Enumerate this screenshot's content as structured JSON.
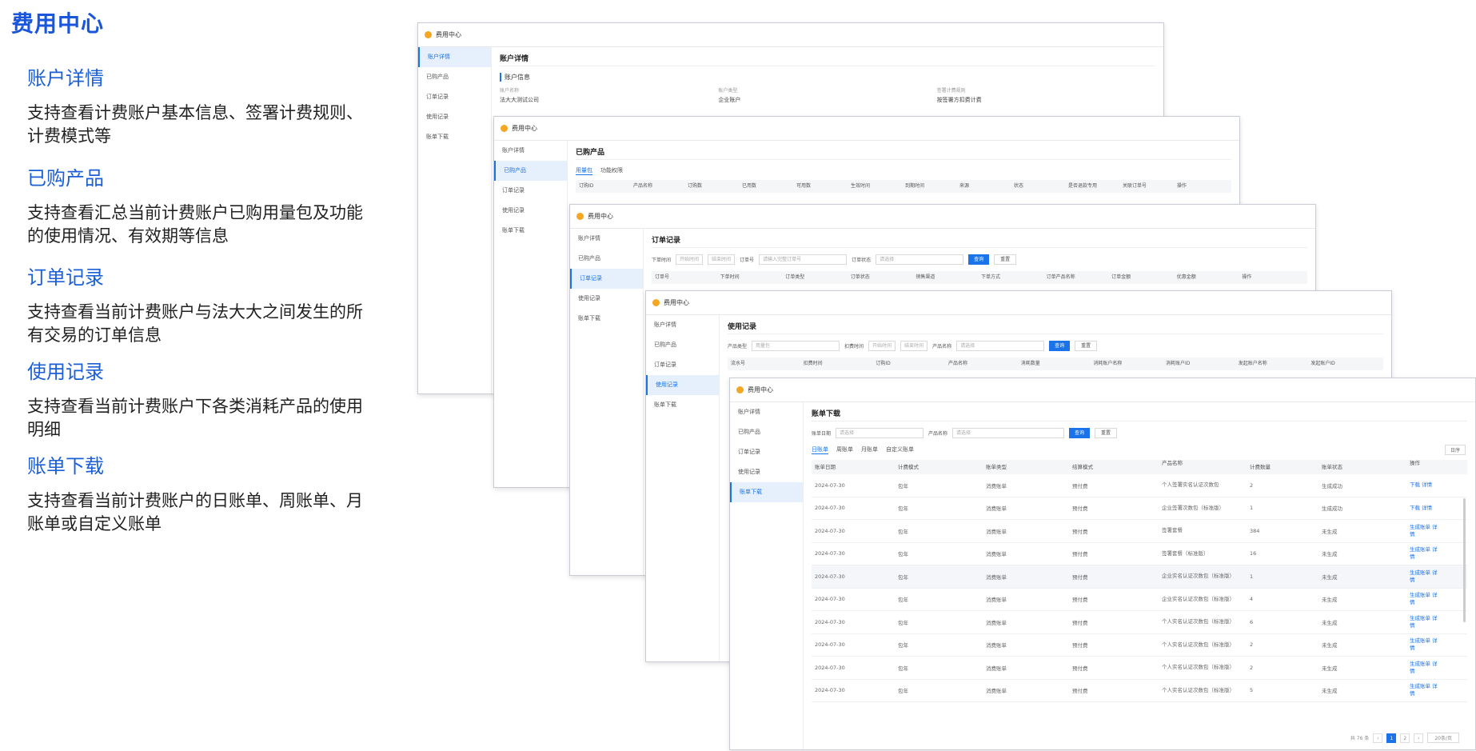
{
  "page": {
    "title": "费用中心",
    "features": [
      {
        "title": "账户详情",
        "desc": "支持查看计费账户基本信息、签署计费规则、计费模式等"
      },
      {
        "title": "已购产品",
        "desc": "支持查看汇总当前计费账户已购用量包及功能的使用情况、有效期等信息"
      },
      {
        "title": "订单记录",
        "desc": "支持查看当前计费账户与法大大之间发生的所有交易的订单信息"
      },
      {
        "title": "使用记录",
        "desc": "支持查看当前计费账户下各类消耗产品的使用明细"
      },
      {
        "title": "账单下载",
        "desc": "支持查看当前计费账户的日账单、周账单、月账单或自定义账单"
      }
    ]
  },
  "app": {
    "name": "费用中心",
    "menu": [
      "账户详情",
      "已购产品",
      "订单记录",
      "使用记录",
      "账单下载"
    ]
  },
  "account": {
    "title": "账户详情",
    "section": "账户信息",
    "labels": [
      "账户名称",
      "账户类型",
      "签署计费规则"
    ],
    "values": [
      "法大大测试公司",
      "企业账户",
      "按签署方扣费计费"
    ]
  },
  "products": {
    "title": "已购产品",
    "tabs": [
      "用量包",
      "功能权限"
    ],
    "columns": [
      "订购ID",
      "产品名称",
      "订购数",
      "已用数",
      "可用数",
      "生效时间",
      "到期时间",
      "来源",
      "状态",
      "是否退款专用",
      "关联订单号",
      "操作"
    ]
  },
  "orders": {
    "title": "订单记录",
    "filters": {
      "time_label": "下单时间",
      "start": "开始时间",
      "end": "结束时间",
      "order_label": "订单号",
      "order_ph": "请输入完整订单号",
      "status_label": "订单状态",
      "status_ph": "请选择"
    },
    "query": "查询",
    "reset": "重置",
    "columns": [
      "订单号",
      "下单时间",
      "订单类型",
      "订单状态",
      "销售渠道",
      "下单方式",
      "订单产品名称",
      "订单金额",
      "优惠金额",
      "操作"
    ]
  },
  "usage": {
    "title": "使用记录",
    "filters": {
      "type_label": "产品类型",
      "type_val": "用量包",
      "time_label": "扣费时间",
      "start": "开始时间",
      "end": "结束时间",
      "name_label": "产品名称",
      "name_ph": "请选择"
    },
    "query": "查询",
    "reset": "重置",
    "columns": [
      "流水号",
      "扣费时间",
      "订购ID",
      "产品名称",
      "消耗数量",
      "消耗账户名称",
      "消耗账户ID",
      "发起账户名称",
      "发起账户ID"
    ]
  },
  "bills": {
    "title": "账单下载",
    "filters": {
      "date_label": "账单日期",
      "date_ph": "请选择",
      "name_label": "产品名称",
      "name_ph": "请选择"
    },
    "query": "查询",
    "reset": "重置",
    "tabs": [
      "日账单",
      "周账单",
      "月账单",
      "自定义账单"
    ],
    "sort": "日序",
    "columns": [
      "账单日期",
      "计费模式",
      "账单类型",
      "结算模式",
      "产品名称",
      "计费数量",
      "账单状态",
      "操作"
    ],
    "rows": [
      {
        "date": "2024-07-30",
        "mode": "包年",
        "type": "消费账单",
        "settle": "预付费",
        "product": "个人签署实名认证次数包",
        "qty": "2",
        "status": "生成成功",
        "op": "下载 详情"
      },
      {
        "date": "2024-07-30",
        "mode": "包年",
        "type": "消费账单",
        "settle": "预付费",
        "product": "企业签署次数包（标准版）",
        "qty": "1",
        "status": "生成成功",
        "op": "下载 详情"
      },
      {
        "date": "2024-07-30",
        "mode": "包年",
        "type": "消费账单",
        "settle": "预付费",
        "product": "签署套餐",
        "qty": "384",
        "status": "未生成",
        "op": "生成账单 详情"
      },
      {
        "date": "2024-07-30",
        "mode": "包年",
        "type": "消费账单",
        "settle": "预付费",
        "product": "签署套餐（标准版）",
        "qty": "16",
        "status": "未生成",
        "op": "生成账单 详情"
      },
      {
        "date": "2024-07-30",
        "mode": "包年",
        "type": "消费账单",
        "settle": "预付费",
        "product": "企业实名认证次数包（标准版）",
        "qty": "1",
        "status": "未生成",
        "op": "生成账单 详情"
      },
      {
        "date": "2024-07-30",
        "mode": "包年",
        "type": "消费账单",
        "settle": "预付费",
        "product": "企业实名认证次数包（标准版）",
        "qty": "4",
        "status": "未生成",
        "op": "生成账单 详情"
      },
      {
        "date": "2024-07-30",
        "mode": "包年",
        "type": "消费账单",
        "settle": "预付费",
        "product": "个人实名认证次数包（标准版）",
        "qty": "6",
        "status": "未生成",
        "op": "生成账单 详情"
      },
      {
        "date": "2024-07-30",
        "mode": "包年",
        "type": "消费账单",
        "settle": "预付费",
        "product": "个人实名认证次数包（标准版）",
        "qty": "2",
        "status": "未生成",
        "op": "生成账单 详情"
      },
      {
        "date": "2024-07-30",
        "mode": "包年",
        "type": "消费账单",
        "settle": "预付费",
        "product": "个人实名认证次数包（标准版）",
        "qty": "2",
        "status": "未生成",
        "op": "生成账单 详情"
      },
      {
        "date": "2024-07-30",
        "mode": "包年",
        "type": "消费账单",
        "settle": "预付费",
        "product": "个人实名认证次数包（标准版）",
        "qty": "5",
        "status": "未生成",
        "op": "生成账单 详情"
      }
    ],
    "pager": {
      "total": "共 76 条",
      "pages": [
        "1",
        "2"
      ],
      "size": "20条/页"
    }
  }
}
